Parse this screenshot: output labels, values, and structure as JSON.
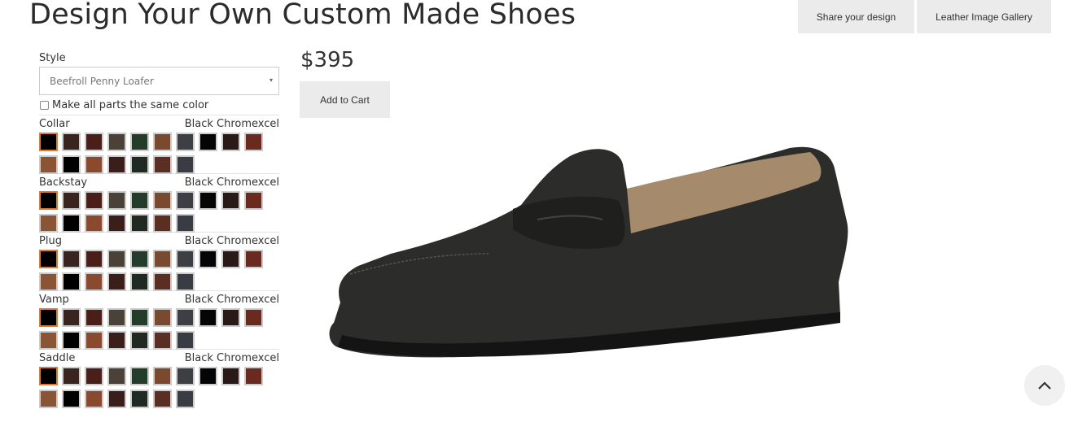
{
  "page": {
    "title": "Design Your Own Custom Made Shoes"
  },
  "header": {
    "share_label": "Share your design",
    "gallery_label": "Leather Image Gallery"
  },
  "style": {
    "label": "Style",
    "selected": "Beefroll Penny Loafer",
    "same_color_label": "Make all parts the same color",
    "same_color_checked": false
  },
  "swatch_colors": [
    "#000000",
    "#3a2420",
    "#4a1f1a",
    "#4a4238",
    "#233d2a",
    "#7a4a30",
    "#3e3f45",
    "#050505",
    "#2a1a17",
    "#6a2a20",
    "#8a5535",
    "#000000",
    "#8a4a30",
    "#3a1e1a",
    "#1f2a22",
    "#5a2e22",
    "#3a3c44"
  ],
  "parts": [
    {
      "name": "Collar",
      "selected_color": "Black Chromexcel"
    },
    {
      "name": "Backstay",
      "selected_color": "Black Chromexcel"
    },
    {
      "name": "Plug",
      "selected_color": "Black Chromexcel"
    },
    {
      "name": "Vamp",
      "selected_color": "Black Chromexcel"
    },
    {
      "name": "Saddle",
      "selected_color": "Black Chromexcel"
    }
  ],
  "product": {
    "price": "$395",
    "add_to_cart_label": "Add to Cart",
    "image_name": "black-penny-loafer-image"
  },
  "icons": {
    "select_arrow": "▾",
    "scroll_top": "chevron-up-icon"
  }
}
